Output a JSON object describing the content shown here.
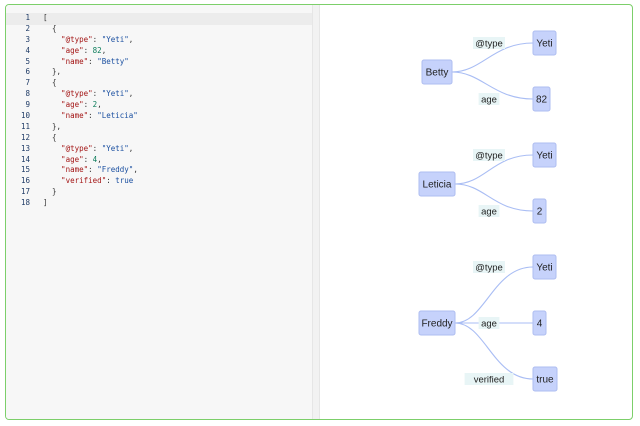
{
  "editor": {
    "line_numbers": [
      "1",
      "2",
      "3",
      "4",
      "5",
      "6",
      "7",
      "8",
      "9",
      "10",
      "11",
      "12",
      "13",
      "14",
      "15",
      "16",
      "17",
      "18"
    ],
    "lines": [
      [
        {
          "t": "p",
          "v": "["
        }
      ],
      [
        {
          "t": "p",
          "v": "  {"
        }
      ],
      [
        {
          "t": "k",
          "v": "    \"@type\""
        },
        {
          "t": "p",
          "v": ": "
        },
        {
          "t": "s",
          "v": "\"Yeti\""
        },
        {
          "t": "p",
          "v": ","
        }
      ],
      [
        {
          "t": "k",
          "v": "    \"age\""
        },
        {
          "t": "p",
          "v": ": "
        },
        {
          "t": "n",
          "v": "82"
        },
        {
          "t": "p",
          "v": ","
        }
      ],
      [
        {
          "t": "k",
          "v": "    \"name\""
        },
        {
          "t": "p",
          "v": ": "
        },
        {
          "t": "s",
          "v": "\"Betty\""
        }
      ],
      [
        {
          "t": "p",
          "v": "  },"
        }
      ],
      [
        {
          "t": "p",
          "v": "  {"
        }
      ],
      [
        {
          "t": "k",
          "v": "    \"@type\""
        },
        {
          "t": "p",
          "v": ": "
        },
        {
          "t": "s",
          "v": "\"Yeti\""
        },
        {
          "t": "p",
          "v": ","
        }
      ],
      [
        {
          "t": "k",
          "v": "    \"age\""
        },
        {
          "t": "p",
          "v": ": "
        },
        {
          "t": "n",
          "v": "2"
        },
        {
          "t": "p",
          "v": ","
        }
      ],
      [
        {
          "t": "k",
          "v": "    \"name\""
        },
        {
          "t": "p",
          "v": ": "
        },
        {
          "t": "s",
          "v": "\"Leticia\""
        }
      ],
      [
        {
          "t": "p",
          "v": "  },"
        }
      ],
      [
        {
          "t": "p",
          "v": "  {"
        }
      ],
      [
        {
          "t": "k",
          "v": "    \"@type\""
        },
        {
          "t": "p",
          "v": ": "
        },
        {
          "t": "s",
          "v": "\"Yeti\""
        },
        {
          "t": "p",
          "v": ","
        }
      ],
      [
        {
          "t": "k",
          "v": "    \"age\""
        },
        {
          "t": "p",
          "v": ": "
        },
        {
          "t": "n",
          "v": "4"
        },
        {
          "t": "p",
          "v": ","
        }
      ],
      [
        {
          "t": "k",
          "v": "    \"name\""
        },
        {
          "t": "p",
          "v": ": "
        },
        {
          "t": "s",
          "v": "\"Freddy\""
        },
        {
          "t": "p",
          "v": ","
        }
      ],
      [
        {
          "t": "k",
          "v": "    \"verified\""
        },
        {
          "t": "p",
          "v": ": "
        },
        {
          "t": "b",
          "v": "true"
        }
      ],
      [
        {
          "t": "p",
          "v": "  }"
        }
      ],
      [
        {
          "t": "p",
          "v": "]"
        }
      ]
    ]
  },
  "graph": {
    "groups": [
      {
        "subject": "Betty",
        "edges": [
          {
            "label": "@type",
            "target": "Yeti"
          },
          {
            "label": "age",
            "target": "82"
          }
        ]
      },
      {
        "subject": "Leticia",
        "edges": [
          {
            "label": "@type",
            "target": "Yeti"
          },
          {
            "label": "age",
            "target": "2"
          }
        ]
      },
      {
        "subject": "Freddy",
        "edges": [
          {
            "label": "@type",
            "target": "Yeti"
          },
          {
            "label": "age",
            "target": "4"
          },
          {
            "label": "verified",
            "target": "true"
          }
        ]
      }
    ]
  },
  "colors": {
    "frame_border": "#7ccf6a",
    "node_fill": "#c6d2fb",
    "edge": "#a9bdf4",
    "json_key": "#a31515",
    "json_string": "#1a4fa0",
    "json_number": "#0b7c5a"
  }
}
